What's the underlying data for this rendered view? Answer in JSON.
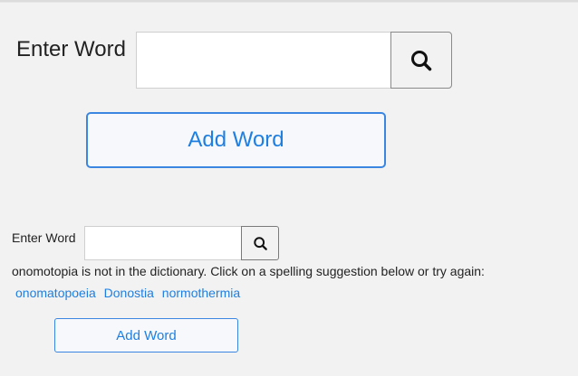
{
  "large_form": {
    "label": "Enter Word",
    "input_value": "",
    "search_icon": "magnifier-icon",
    "add_button_label": "Add Word"
  },
  "small_form": {
    "label": "Enter Word",
    "input_value": "",
    "search_icon": "magnifier-icon",
    "message": "onomotopia is not in the dictionary. Click on a spelling suggestion below or try again:",
    "suggestions": [
      "onomatopoeia",
      "Donostia",
      "normothermia"
    ],
    "add_button_label": "Add Word"
  },
  "colors": {
    "background": "#f2f2f2",
    "accent": "#1f7fe0",
    "button_border": "#3a86e0"
  }
}
